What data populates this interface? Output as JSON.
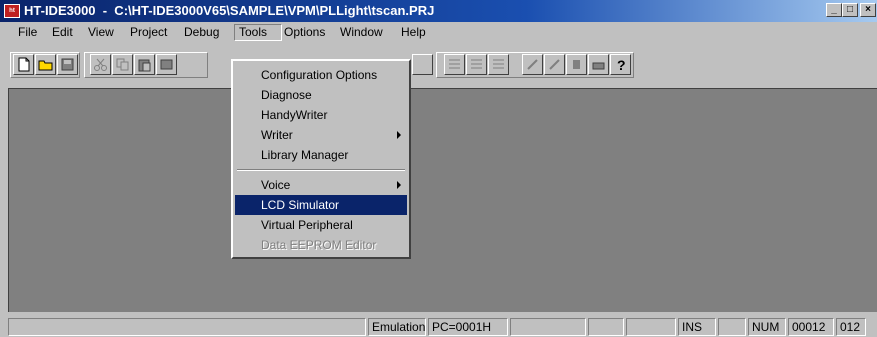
{
  "window": {
    "app_icon_text": "ht",
    "title": "HT-IDE3000  -  C:\\HT-IDE3000V65\\SAMPLE\\VPM\\PLLight\\tscan.PRJ",
    "minimize": "_",
    "maximize": "□",
    "close": "×"
  },
  "menubar": {
    "items": [
      {
        "label": "File"
      },
      {
        "label": "Edit"
      },
      {
        "label": "View"
      },
      {
        "label": "Project"
      },
      {
        "label": "Debug"
      },
      {
        "label": "Tools"
      },
      {
        "label": "Options"
      },
      {
        "label": "Window"
      },
      {
        "label": "Help"
      }
    ]
  },
  "tools_menu": {
    "items": [
      {
        "label": "Configuration Options"
      },
      {
        "label": "Diagnose"
      },
      {
        "label": "HandyWriter"
      },
      {
        "label": "Writer"
      },
      {
        "label": "Library Manager"
      },
      {
        "label": "Voice"
      },
      {
        "label": "LCD Simulator"
      },
      {
        "label": "Virtual Peripheral"
      },
      {
        "label": "Data EEPROM Editor"
      }
    ]
  },
  "statusbar": {
    "mode": "Emulation",
    "pc": "PC=0001H",
    "ins": "INS",
    "num": "NUM",
    "line": "00012",
    "col": "012"
  }
}
